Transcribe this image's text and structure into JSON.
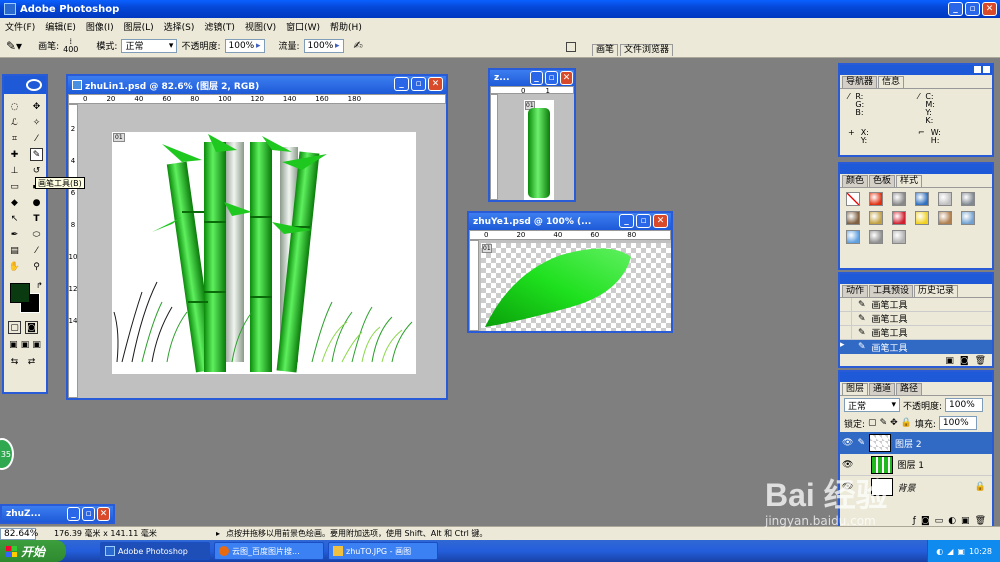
{
  "app": {
    "title": "Adobe Photoshop"
  },
  "menu": [
    "文件(F)",
    "编辑(E)",
    "图像(I)",
    "图层(L)",
    "选择(S)",
    "滤镜(T)",
    "视图(V)",
    "窗口(W)",
    "帮助(H)"
  ],
  "options": {
    "brush_label": "画笔:",
    "brush_size": "400",
    "mode_label": "模式:",
    "mode_value": "正常",
    "opacity_label": "不透明度:",
    "opacity_value": "100%",
    "flow_label": "流量:",
    "flow_value": "100%",
    "well_tabs": [
      "画笔",
      "文件浏览器"
    ]
  },
  "tooltip": "画笔工具(B)",
  "docs": {
    "main": {
      "title": "zhuLin1.psd @ 82.6% (图层 2, RGB)",
      "ruler_h": [
        "0",
        "20",
        "40",
        "60",
        "80",
        "100",
        "120",
        "140",
        "160",
        "180"
      ],
      "ruler_v": [
        "2",
        "4",
        "6",
        "8",
        "10",
        "12",
        "14"
      ],
      "tag": "01"
    },
    "small": {
      "title": "z...",
      "ruler_h": [
        "0",
        "1"
      ],
      "tag": "01"
    },
    "leaf": {
      "title": "zhuYe1.psd @ 100% (...",
      "ruler_h": [
        "0",
        "20",
        "40",
        "60",
        "80"
      ],
      "tag": "01"
    },
    "min": {
      "title": "zhuZ..."
    }
  },
  "info_panel": {
    "tabs": [
      "导航器",
      "信息"
    ],
    "rgb": "R:\nG:\nB:",
    "cmyk": "C:\nM:\nY:\nK:",
    "xy": "X:\nY:",
    "wh": "W:\nH:"
  },
  "color_panel": {
    "tabs": [
      "颜色",
      "色板",
      "样式"
    ],
    "styles": [
      "#ffffff",
      "#e03010",
      "#888888",
      "#3070c0",
      "#c0c0c0",
      "#808890",
      "#806040",
      "#c0a040",
      "#d02030",
      "#f0d020",
      "#b08050",
      "#70a0d0",
      "#60a0e0",
      "#909090",
      "#b0b0b0"
    ]
  },
  "history_panel": {
    "tabs": [
      "动作",
      "工具预设",
      "历史记录"
    ],
    "items": [
      "画笔工具",
      "画笔工具",
      "画笔工具",
      "画笔工具"
    ]
  },
  "layers_panel": {
    "tabs": [
      "图层",
      "通道",
      "路径"
    ],
    "blend": "正常",
    "opacity_label": "不透明度:",
    "opacity": "100%",
    "lock_label": "锁定:",
    "fill_label": "填充:",
    "fill": "100%",
    "layers": [
      "图层 2",
      "图层 1",
      "背景"
    ]
  },
  "status": {
    "zoom": "82.64%",
    "size": "176.39 毫米 x 141.11 毫米",
    "hint": "点按并拖移以用前景色绘画。要用附加选项，使用 Shift、Alt 和 Ctrl 键。"
  },
  "taskbar": {
    "start": "开始",
    "items": [
      "Adobe Photoshop",
      "云图_百度图片搜...",
      "zhuTO.JPG - 画图"
    ],
    "time": "10:28"
  },
  "watermark": {
    "logo": "Bai 经验",
    "url": "jingyan.baidu.com"
  },
  "side_badge": "35",
  "colors": {
    "xp_blue": "#0548d8",
    "bamboo_green": "#1fb81f",
    "foreground": "#0a3a10",
    "taskbar": "#245edb"
  }
}
